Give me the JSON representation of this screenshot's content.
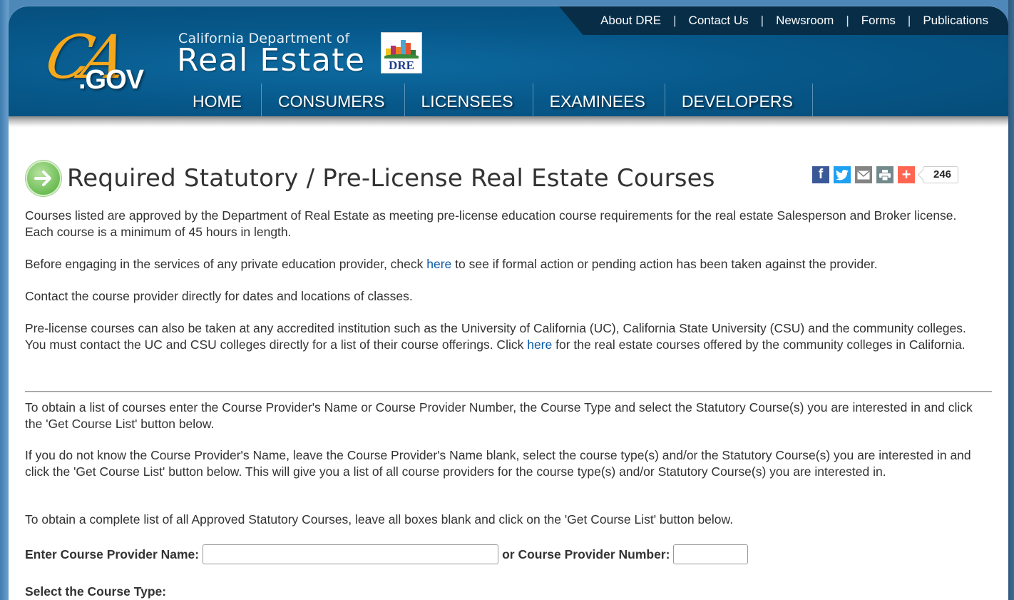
{
  "header": {
    "ca_logo_script": "CA",
    "ca_logo_domain": ".GOV",
    "agency_subtitle": "California Department of",
    "agency_title": "Real Estate",
    "badge_text": "DRE",
    "utility_links": [
      {
        "label": "About DRE"
      },
      {
        "label": "Contact Us"
      },
      {
        "label": "Newsroom"
      },
      {
        "label": "Forms"
      },
      {
        "label": "Publications"
      }
    ],
    "separator": "|",
    "nav": [
      {
        "label": "HOME"
      },
      {
        "label": "CONSUMERS"
      },
      {
        "label": "LICENSEES"
      },
      {
        "label": "EXAMINEES"
      },
      {
        "label": "DEVELOPERS"
      }
    ]
  },
  "page": {
    "title": "Required Statutory / Pre-License Real Estate Courses",
    "share": {
      "buttons": [
        {
          "icon": "facebook-icon",
          "glyph": "f",
          "color": "#3b5998"
        },
        {
          "icon": "twitter-icon",
          "glyph": "🐦",
          "color": "#1da1f2"
        },
        {
          "icon": "email-icon",
          "glyph": "✉",
          "color": "#848484"
        },
        {
          "icon": "print-icon",
          "glyph": "⎙",
          "color": "#738a8d"
        },
        {
          "icon": "addthis-plus-icon",
          "glyph": "+",
          "color": "#ff6550"
        }
      ],
      "count": "246"
    },
    "paragraphs": {
      "p1": "Courses listed are approved by the Department of Real Estate as meeting pre-license education course requirements for the real estate Salesperson and Broker license. Each course is a minimum of 45 hours in length.",
      "p2_before": "Before engaging in the services of any private education provider, check ",
      "p2_link": "here",
      "p2_after": " to see if formal action or pending action has been taken against the provider.",
      "p3": "Contact the course provider directly for dates and locations of classes.",
      "p4_before": "Pre-license courses can also be taken at any accredited institution such as the University of California (UC), California State University (CSU) and the community colleges. You must contact the UC and CSU colleges directly for a list of their course offerings. Click ",
      "p4_link": "here",
      "p4_after": " for the real estate courses offered by the community colleges in California.",
      "p5": "To obtain a list of courses enter the Course Provider's Name or Course Provider Number, the Course Type and select the Statutory Course(s) you are interested in and click the 'Get Course List' button below.",
      "p6": "If you do not know the Course Provider's Name, leave the Course Provider's Name blank, select the course type(s) and/or the Statutory Course(s) you are interested in and click the 'Get Course List' button below. This will give you a list of all course providers for the course type(s) and/or Statutory Course(s) you are interested in.",
      "p7": "To obtain a complete list of all Approved Statutory Courses, leave all boxes blank and click on the 'Get Course List' button below."
    },
    "form": {
      "provider_name_label": "Enter Course Provider Name:",
      "provider_name_value": "",
      "provider_number_label": "or Course Provider Number:",
      "provider_number_value": "",
      "course_type_label": "Select the Course Type:"
    }
  }
}
